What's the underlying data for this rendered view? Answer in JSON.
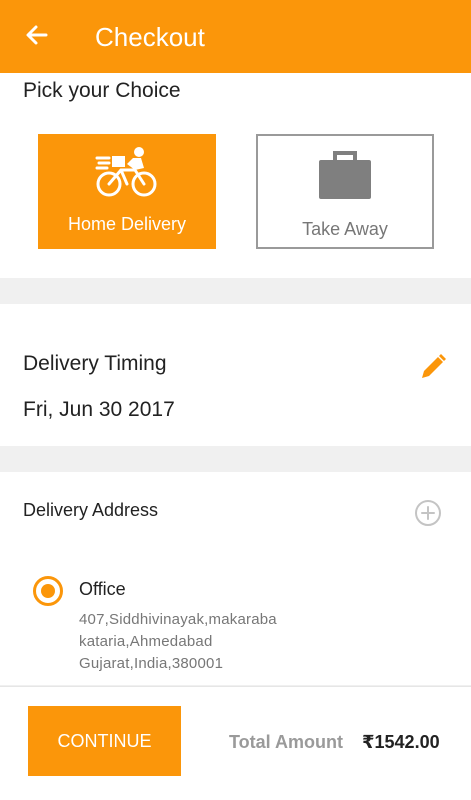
{
  "appbar": {
    "title": "Checkout",
    "back_icon": "arrow-left-icon"
  },
  "colors": {
    "accent": "#fb960a",
    "muted": "#9a9a9a"
  },
  "choice": {
    "title": "Pick your Choice",
    "options": [
      {
        "label": "Home Delivery",
        "icon": "delivery-bike-icon",
        "selected": true
      },
      {
        "label": "Take Away",
        "icon": "briefcase-icon",
        "selected": false
      }
    ]
  },
  "timing": {
    "title": "Delivery Timing",
    "date": "Fri, Jun 30 2017",
    "edit_icon": "pencil-icon"
  },
  "address": {
    "title": "Delivery Address",
    "add_icon": "plus-circle-icon",
    "items": [
      {
        "name": "Office",
        "line1": "407,Siddhivinayak,makaraba",
        "line2": "kataria,Ahmedabad",
        "line3": "Gujarat,India,380001",
        "selected": true
      }
    ]
  },
  "footer": {
    "continue_label": "CONTINUE",
    "total_label": "Total Amount",
    "total_value": "₹1542.00"
  }
}
